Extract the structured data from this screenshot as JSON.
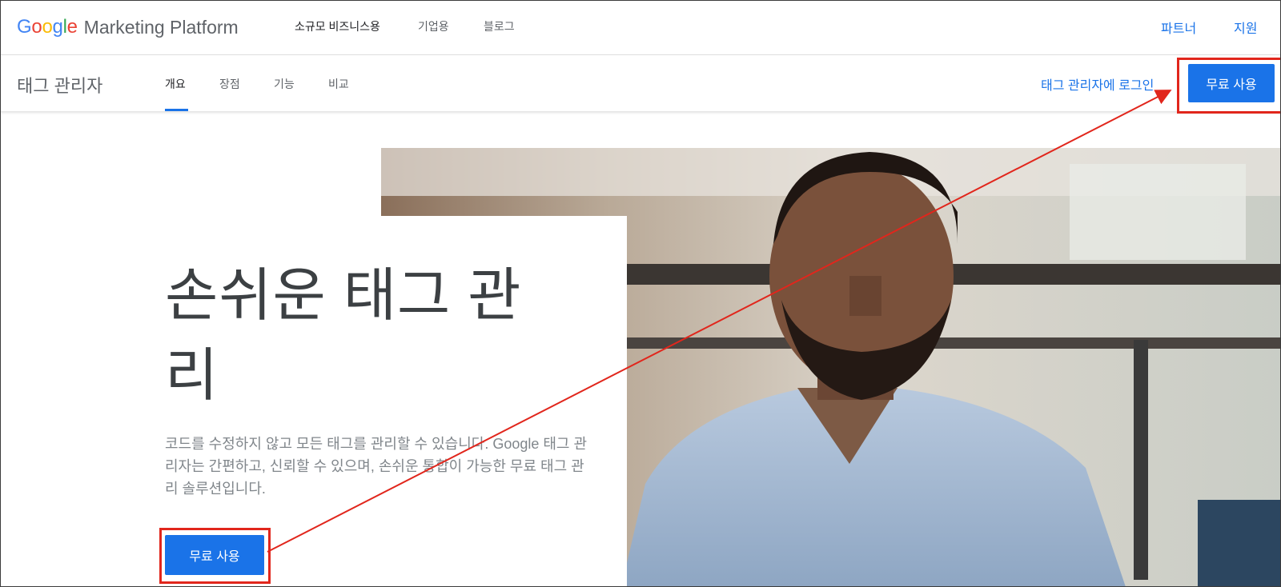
{
  "topbar": {
    "brand": {
      "google_letters": [
        "G",
        "o",
        "o",
        "g",
        "l",
        "e"
      ],
      "product": "Marketing Platform"
    },
    "nav": [
      "소규모 비즈니스용",
      "기업용",
      "블로그"
    ],
    "right_links": [
      "파트너",
      "지원"
    ]
  },
  "subnav": {
    "product_name": "태그 관리자",
    "tabs": [
      "개요",
      "장점",
      "기능",
      "비교"
    ],
    "active_tab": "개요",
    "login_link": "태그 관리자에 로그인",
    "cta": "무료 사용"
  },
  "hero": {
    "headline": "손쉬운 태그 관리",
    "description": "코드를 수정하지 않고 모든 태그를 관리할 수 있습니다. Google 태그 관리자는 간편하고, 신뢰할 수 있으며, 손쉬운 통합이 가능한 무료 태그 관리 솔루션입니다.",
    "cta": "무료 사용"
  },
  "colors": {
    "google_blue": "#4285F4",
    "google_red": "#EA4335",
    "google_yellow": "#FBBC05",
    "google_green": "#34A853",
    "accent": "#1a73e8",
    "annotation": "#e1261c"
  }
}
